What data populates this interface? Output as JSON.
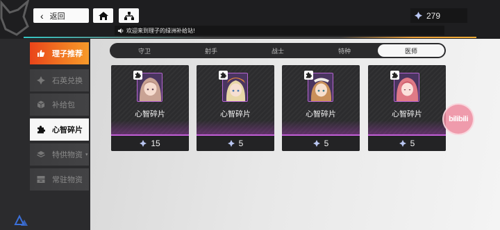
{
  "header": {
    "back_label": "返回",
    "notice_text": "欢迎来到理子的绿洲补给站!",
    "currency_amount": "279"
  },
  "sidebar": {
    "items": [
      {
        "label": "理子推荐",
        "icon": "thumbs-up-icon"
      },
      {
        "label": "石英兑换",
        "icon": "quartz-icon"
      },
      {
        "label": "补给包",
        "icon": "package-icon"
      },
      {
        "label": "心智碎片",
        "icon": "puzzle-icon"
      },
      {
        "label": "特供物资",
        "icon": "layers-icon"
      },
      {
        "label": "常驻物资",
        "icon": "storage-icon"
      }
    ]
  },
  "tabs": [
    {
      "label": "守卫"
    },
    {
      "label": "射手"
    },
    {
      "label": "战士"
    },
    {
      "label": "特种"
    },
    {
      "label": "医师"
    }
  ],
  "cards": [
    {
      "name": "心智碎片",
      "price": "15",
      "hair": "#c9a394"
    },
    {
      "name": "心智碎片",
      "price": "5",
      "hair": "#e8d7a8"
    },
    {
      "name": "心智碎片",
      "price": "5",
      "hair": "#c9905a"
    },
    {
      "name": "心智碎片",
      "price": "5",
      "hair": "#e07a86"
    }
  ],
  "watermark": {
    "text": "bilibili"
  },
  "colors": {
    "accent_orange": "#f27b22",
    "card_purple": "#c35fd8",
    "accent_teal": "#35c8c6"
  }
}
